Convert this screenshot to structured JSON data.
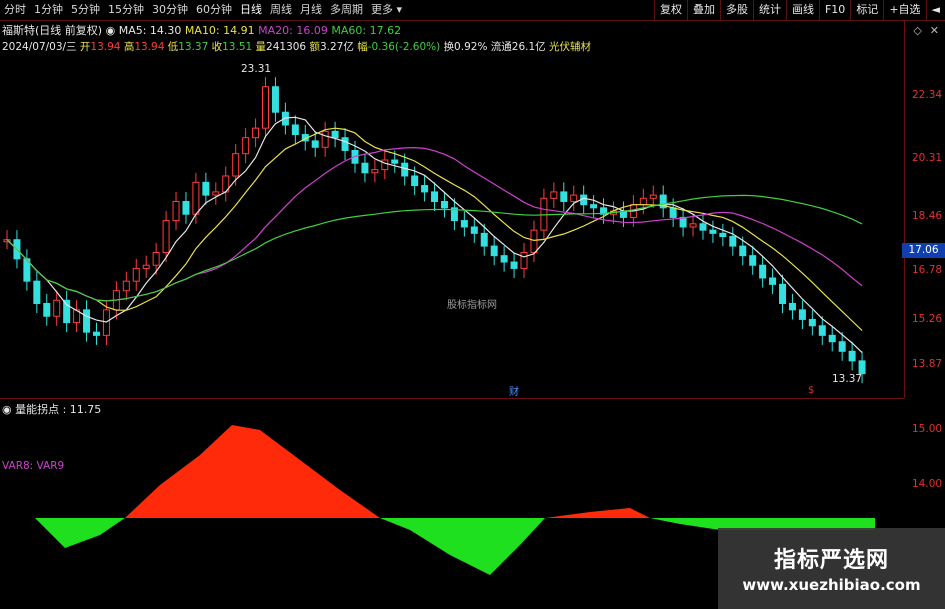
{
  "toolbar": {
    "periods": [
      "分时",
      "1分钟",
      "5分钟",
      "15分钟",
      "30分钟",
      "60分钟",
      "日线",
      "周线",
      "月线",
      "多周期",
      "更多"
    ],
    "active_period": "日线",
    "buttons": [
      "复权",
      "叠加",
      "多股",
      "统计",
      "画线",
      "F10",
      "标记",
      "+自选",
      "◄"
    ]
  },
  "stock": {
    "name": "福斯特",
    "mode": "(日线 前复权)",
    "ma5": "MA5: 14.30",
    "ma10": "MA10: 14.91",
    "ma20": "MA20: 16.09",
    "ma60": "MA60: 17.62"
  },
  "quote": {
    "date": "2024/07/03/三",
    "open_label": "开",
    "open": "13.94",
    "high_label": "高",
    "high": "13.94",
    "low_label": "低",
    "low": "13.37",
    "close_label": "收",
    "close": "13.51",
    "vol_label": "量",
    "vol": "241306",
    "amount_label": "额",
    "amount": "3.27亿",
    "change_label": "幅",
    "change": "-0.36(-2.60%)",
    "turnover": "换0.92%",
    "float": "流通26.1亿",
    "sector": "光伏辅材"
  },
  "main_axis": [
    "22.34",
    "20.31",
    "18.46",
    "16.78",
    "15.26",
    "13.87"
  ],
  "current_price": "17.06",
  "high_mark": "23.31",
  "low_mark": "13.37",
  "mid_watermark": "股标指标网",
  "cai_label": "财",
  "dollar_label": "$",
  "indicator": {
    "title": "量能拐点 : 11.75",
    "vars": "VAR8: VAR9",
    "axis": [
      "15.00",
      "14.00"
    ]
  },
  "brand": {
    "cn": "指标严选网",
    "url": "www.xuezhibiao.com"
  },
  "colors": {
    "up": "#ff3c3c",
    "down": "#33e0e0",
    "ma5": "#e6e6e6",
    "ma10": "#e8e04a",
    "ma20": "#d040d0",
    "ma60": "#3fcf3f",
    "pos_area": "#ff2a0a",
    "neg_area": "#1ee01e"
  },
  "window_icons": [
    "restore-icon",
    "close-icon"
  ]
}
